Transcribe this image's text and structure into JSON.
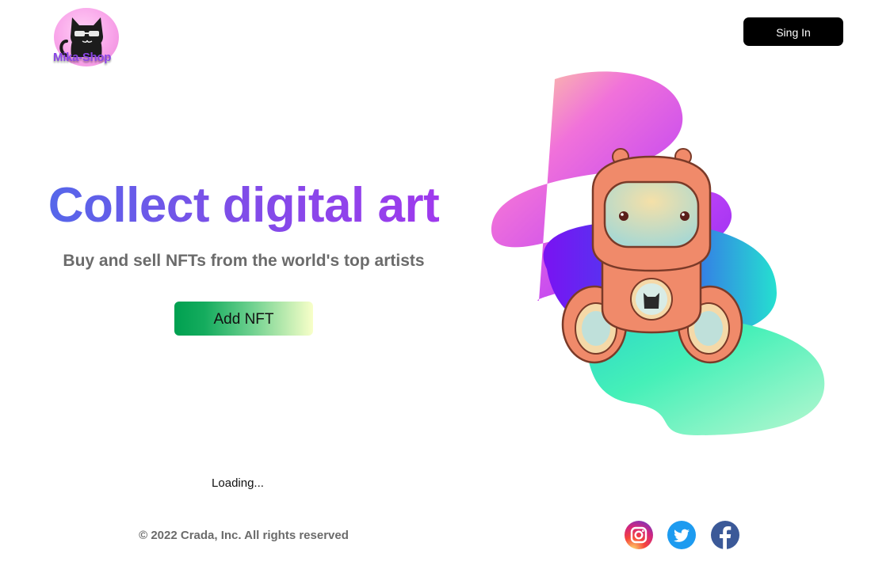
{
  "header": {
    "logo_text": "Mika-Shop",
    "signin_label": "Sing In"
  },
  "hero": {
    "title": "Collect digital art",
    "subtitle": "Buy and sell NFTs from the world's top artists",
    "add_nft_label": "Add NFT"
  },
  "status": {
    "loading_text": "Loading..."
  },
  "footer": {
    "copyright": "© 2022 Crada, Inc. All rights reserved",
    "social": [
      {
        "name": "instagram-icon"
      },
      {
        "name": "twitter-icon"
      },
      {
        "name": "facebook-icon"
      }
    ]
  },
  "colors": {
    "title_gradient_start": "#4e6bea",
    "title_gradient_end": "#a436ee",
    "button_gradient_start": "#00a050",
    "button_gradient_end": "#f8ffc9",
    "signin_bg": "#000000",
    "muted_text": "#6b6b6b"
  }
}
